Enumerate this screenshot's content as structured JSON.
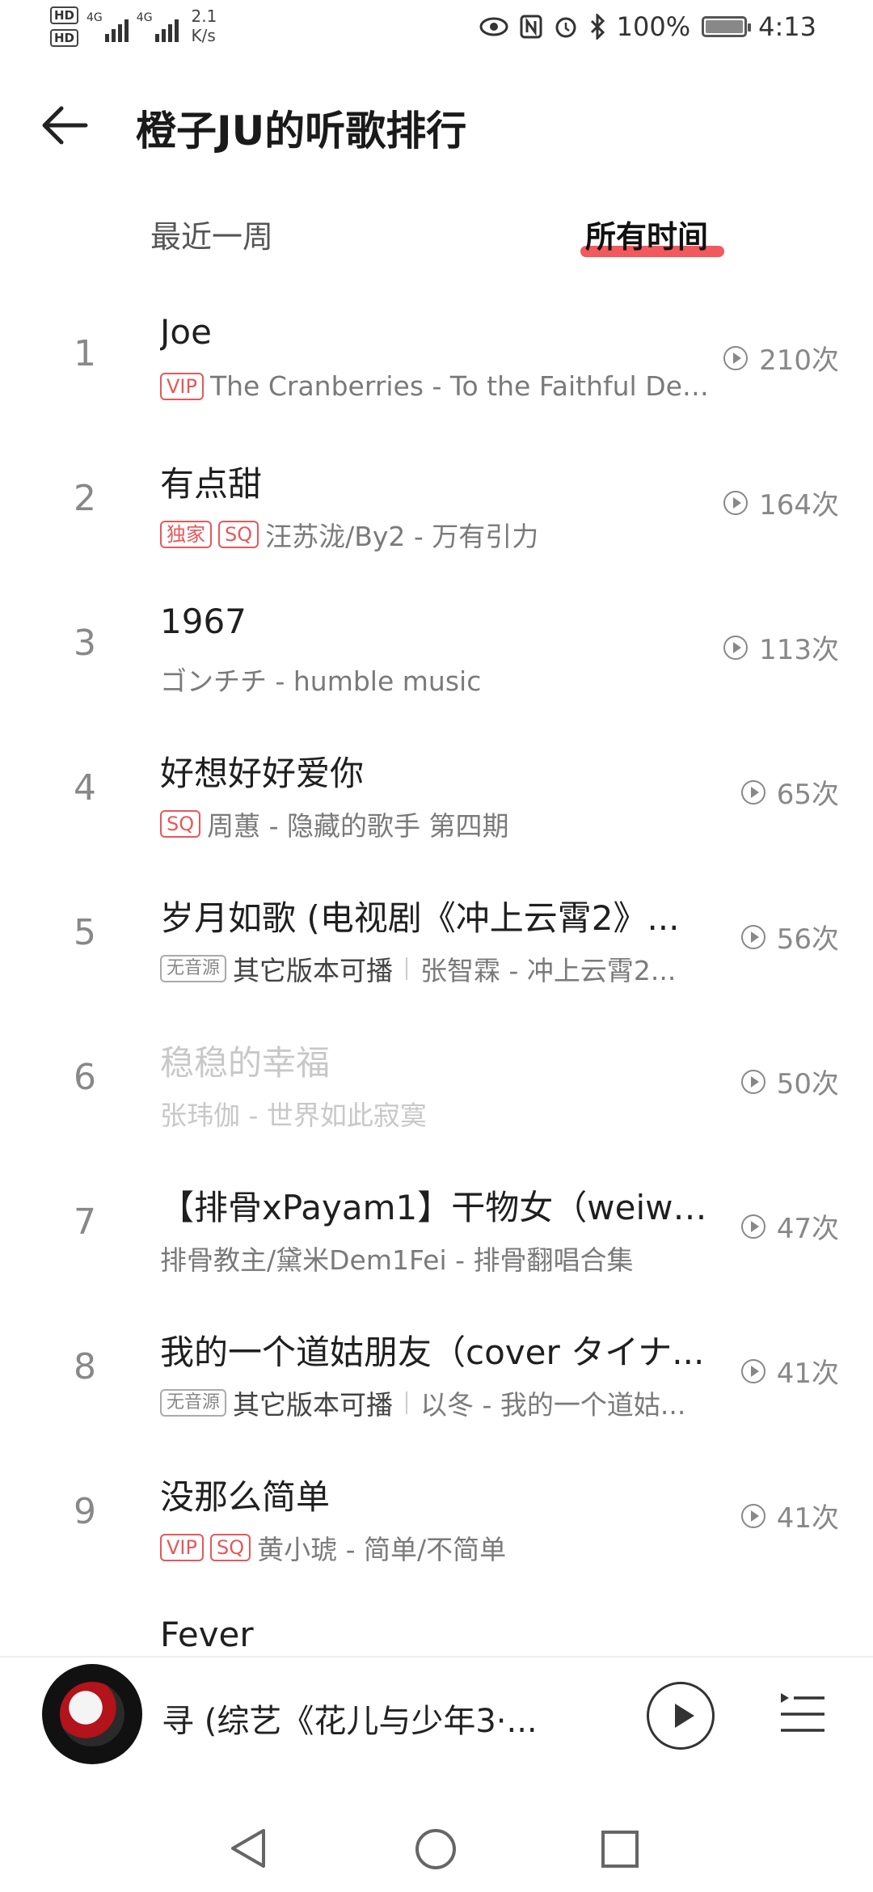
{
  "status_bar": {
    "hd_labels": [
      "HD",
      "HD"
    ],
    "network_labels": [
      "4G",
      "4G"
    ],
    "speed_value": "2.1",
    "speed_unit": "K/s",
    "battery_text": "100%",
    "time": "4:13"
  },
  "header": {
    "title": "橙子JU的听歌排行"
  },
  "tabs": [
    {
      "label": "最近一周",
      "active": false
    },
    {
      "label": "所有时间",
      "active": true
    }
  ],
  "songs": [
    {
      "rank": "1",
      "title": "Joe",
      "badges": [
        "VIP"
      ],
      "meta": "The Cranberries - To the Faithful Depa...",
      "plays": "210次"
    },
    {
      "rank": "2",
      "title": "有点甜",
      "badges": [
        "独家",
        "SQ"
      ],
      "meta": "汪苏泷/By2 - 万有引力",
      "plays": "164次"
    },
    {
      "rank": "3",
      "title": "1967",
      "badges": [],
      "meta": "ゴンチチ - humble music",
      "plays": "113次"
    },
    {
      "rank": "4",
      "title": "好想好好爱你",
      "badges": [
        "SQ"
      ],
      "meta": "周蕙 - 隐藏的歌手 第四期",
      "plays": "65次"
    },
    {
      "rank": "5",
      "title": "岁月如歌 (电视剧《冲上云霄2》...",
      "badges": [
        "无音源"
      ],
      "alt_version": "其它版本可播",
      "meta": "张智霖 - 冲上云霄2...",
      "plays": "56次"
    },
    {
      "rank": "6",
      "title": "稳稳的幸福",
      "badges": [],
      "meta": "张玮伽 - 世界如此寂寞",
      "plays": "50次",
      "dim": true
    },
    {
      "rank": "7",
      "title": "【排骨xPayam1】干物女（weiwe...",
      "badges": [],
      "meta": "排骨教主/黛米Dem1Fei - 排骨翻唱合集",
      "plays": "47次"
    },
    {
      "rank": "8",
      "title": "我的一个道姑朋友（cover タイナ...",
      "badges": [
        "无音源"
      ],
      "alt_version": "其它版本可播",
      "meta": "以冬 - 我的一个道姑...",
      "plays": "41次"
    },
    {
      "rank": "9",
      "title": "没那么简单",
      "badges": [
        "VIP",
        "SQ"
      ],
      "meta": "黄小琥 - 简单/不简单",
      "plays": "41次"
    },
    {
      "rank": "",
      "title": "Fever",
      "badges": [],
      "meta": "",
      "plays": ""
    }
  ],
  "mini_player": {
    "title": "寻 (综艺《花儿与少年3·..."
  },
  "colors": {
    "accent": "#f0474b",
    "badge_red": "#e8575a",
    "text_dim": "#c8c8c8"
  }
}
